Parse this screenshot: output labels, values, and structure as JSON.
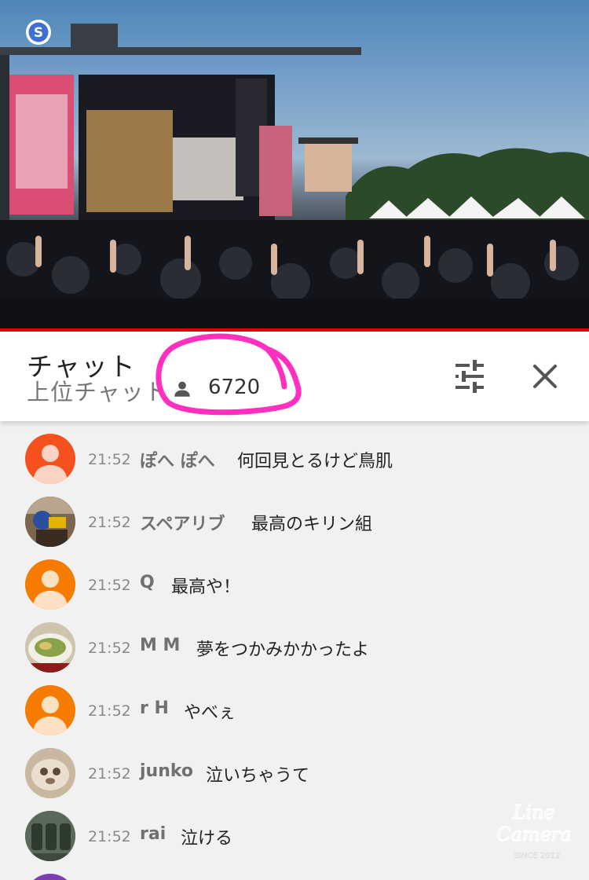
{
  "video": {
    "channel_logo_letter": "S"
  },
  "chat": {
    "title": "チャット",
    "mode": "上位チャット",
    "viewer_count": "6720",
    "filter_icon": "sliders-icon",
    "close_icon": "close-icon"
  },
  "messages": [
    {
      "time": "21:52",
      "author": "ぽへ ぽへ",
      "text": "何回見とるけど鳥肌",
      "avatar": "default-orange-red"
    },
    {
      "time": "21:52",
      "author": "スペアリブ",
      "text": "最高のキリン組",
      "avatar": "photo"
    },
    {
      "time": "21:52",
      "author": "Q",
      "text": "最高や！",
      "avatar": "default-orange"
    },
    {
      "time": "21:52",
      "author": "M M",
      "text": "夢をつかみかかったよ",
      "avatar": "photo"
    },
    {
      "time": "21:52",
      "author": "r H",
      "text": "やべぇ",
      "avatar": "default-orange"
    },
    {
      "time": "21:52",
      "author": "junko",
      "text": "泣いちゃうて",
      "avatar": "photo"
    },
    {
      "time": "21:52",
      "author": "rai",
      "text": "泣ける",
      "avatar": "photo"
    }
  ],
  "watermark": {
    "line1": "Line",
    "line2": "Camera",
    "line3": "SINCE 2012"
  },
  "colors": {
    "progress": "#e00000",
    "annotation": "#ff2fbf",
    "avatar_orange": "#f57c00",
    "avatar_red": "#f4511e"
  }
}
